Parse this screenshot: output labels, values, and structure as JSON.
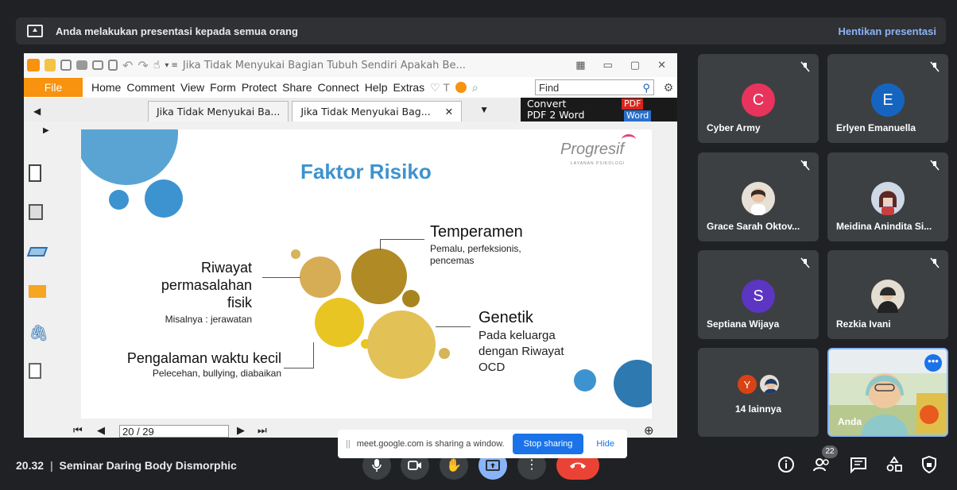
{
  "banner": {
    "text": "Anda melakukan presentasi kepada semua orang",
    "stop": "Hentikan presentasi"
  },
  "reader": {
    "title": "Jika Tidak Menyukai Bagian Tubuh Sendiri Apakah Be...",
    "menu": [
      "File",
      "Home",
      "Comment",
      "View",
      "Form",
      "Protect",
      "Share",
      "Connect",
      "Help",
      "Extras"
    ],
    "find_placeholder": "Find",
    "tabs": [
      "Jika Tidak Menyukai Ba...",
      "Jika Tidak Menyukai Bag..."
    ],
    "ad": {
      "line1": "Convert",
      "line2": "PDF 2 Word",
      "pdf": "PDF",
      "word": "Word"
    },
    "page": "20 / 29"
  },
  "slide": {
    "title": "Faktor Risiko",
    "brand": "Progresif",
    "brand_sub": "LAYANAN PSIKOLOGI",
    "temperamen": {
      "head": "Temperamen",
      "sub1": "Pemalu, perfeksionis,",
      "sub2": "pencemas"
    },
    "riwayat": {
      "l1": "Riwayat",
      "l2": "permasalahan",
      "l3": "fisik",
      "sub": "Misalnya : jerawatan"
    },
    "genetik": {
      "head": "Genetik",
      "l1": "Pada keluarga",
      "l2": "dengan Riwayat",
      "l3": "OCD"
    },
    "pengalaman": {
      "head": "Pengalaman waktu kecil",
      "sub": "Pelecehan, bullying, diabaikan"
    }
  },
  "participants": [
    {
      "name": "Cyber Army",
      "initial": "C",
      "color": "#e8335d"
    },
    {
      "name": "Erlyen Emanuella",
      "initial": "E",
      "color": "#1565c0"
    },
    {
      "name": "Grace Sarah Oktov..."
    },
    {
      "name": "Meidina Anindita Si..."
    },
    {
      "name": "Septiana Wijaya",
      "initial": "S",
      "color": "#5c35c2"
    },
    {
      "name": "Rezkia Ivani"
    },
    {
      "name": "14 lainnya",
      "initial": "Y",
      "color": "#d84315"
    },
    {
      "name": "Anda"
    }
  ],
  "sharing": {
    "text": "meet.google.com is sharing a window.",
    "stop": "Stop sharing",
    "hide": "Hide"
  },
  "meeting": {
    "time": "20.32",
    "title": "Seminar Daring Body Dismorphic",
    "sep": "|",
    "people_count": "22"
  }
}
